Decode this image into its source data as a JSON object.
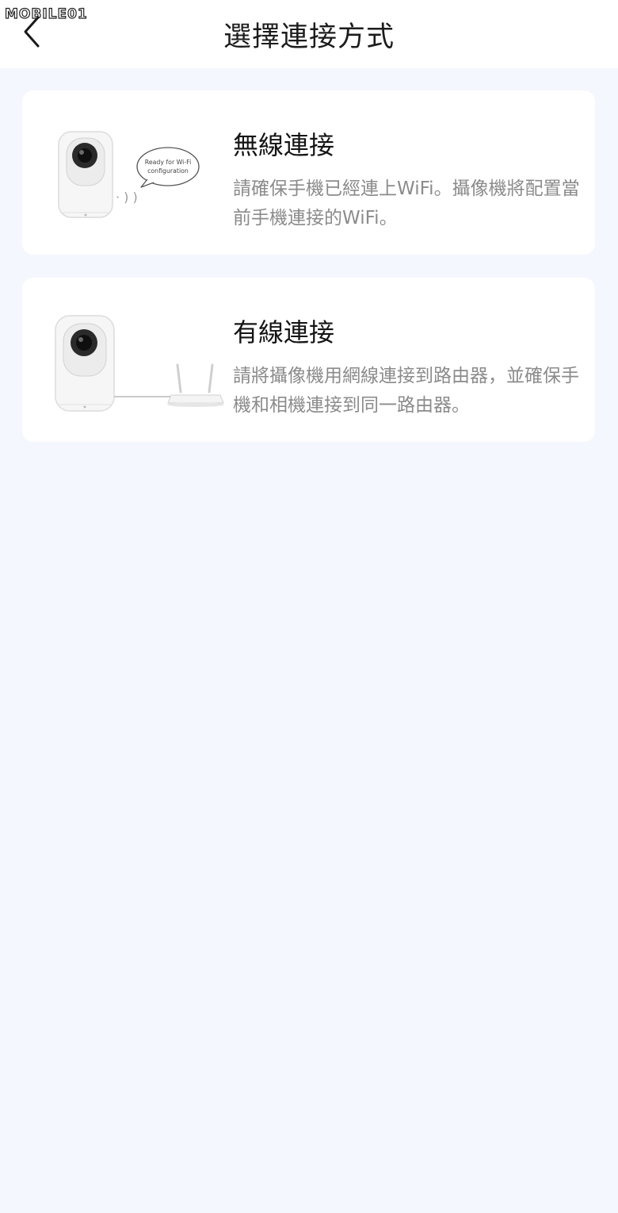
{
  "watermark": {
    "text": "MOBILE01"
  },
  "header": {
    "title": "選擇連接方式"
  },
  "options": [
    {
      "title": "無線連接",
      "description": "請確保手機已經連上WiFi。攝像機將配置當前手機連接的WiFi。",
      "bubble_line1": "Ready for Wi-Fi",
      "bubble_line2": "configuration"
    },
    {
      "title": "有線連接",
      "description": "請將攝像機用網線連接到路由器，並確保手機和相機連接到同一路由器。"
    }
  ],
  "colors": {
    "background": "#f4f7fd",
    "card": "#ffffff",
    "title_text": "#141414",
    "description_text": "#8b8b8b"
  }
}
